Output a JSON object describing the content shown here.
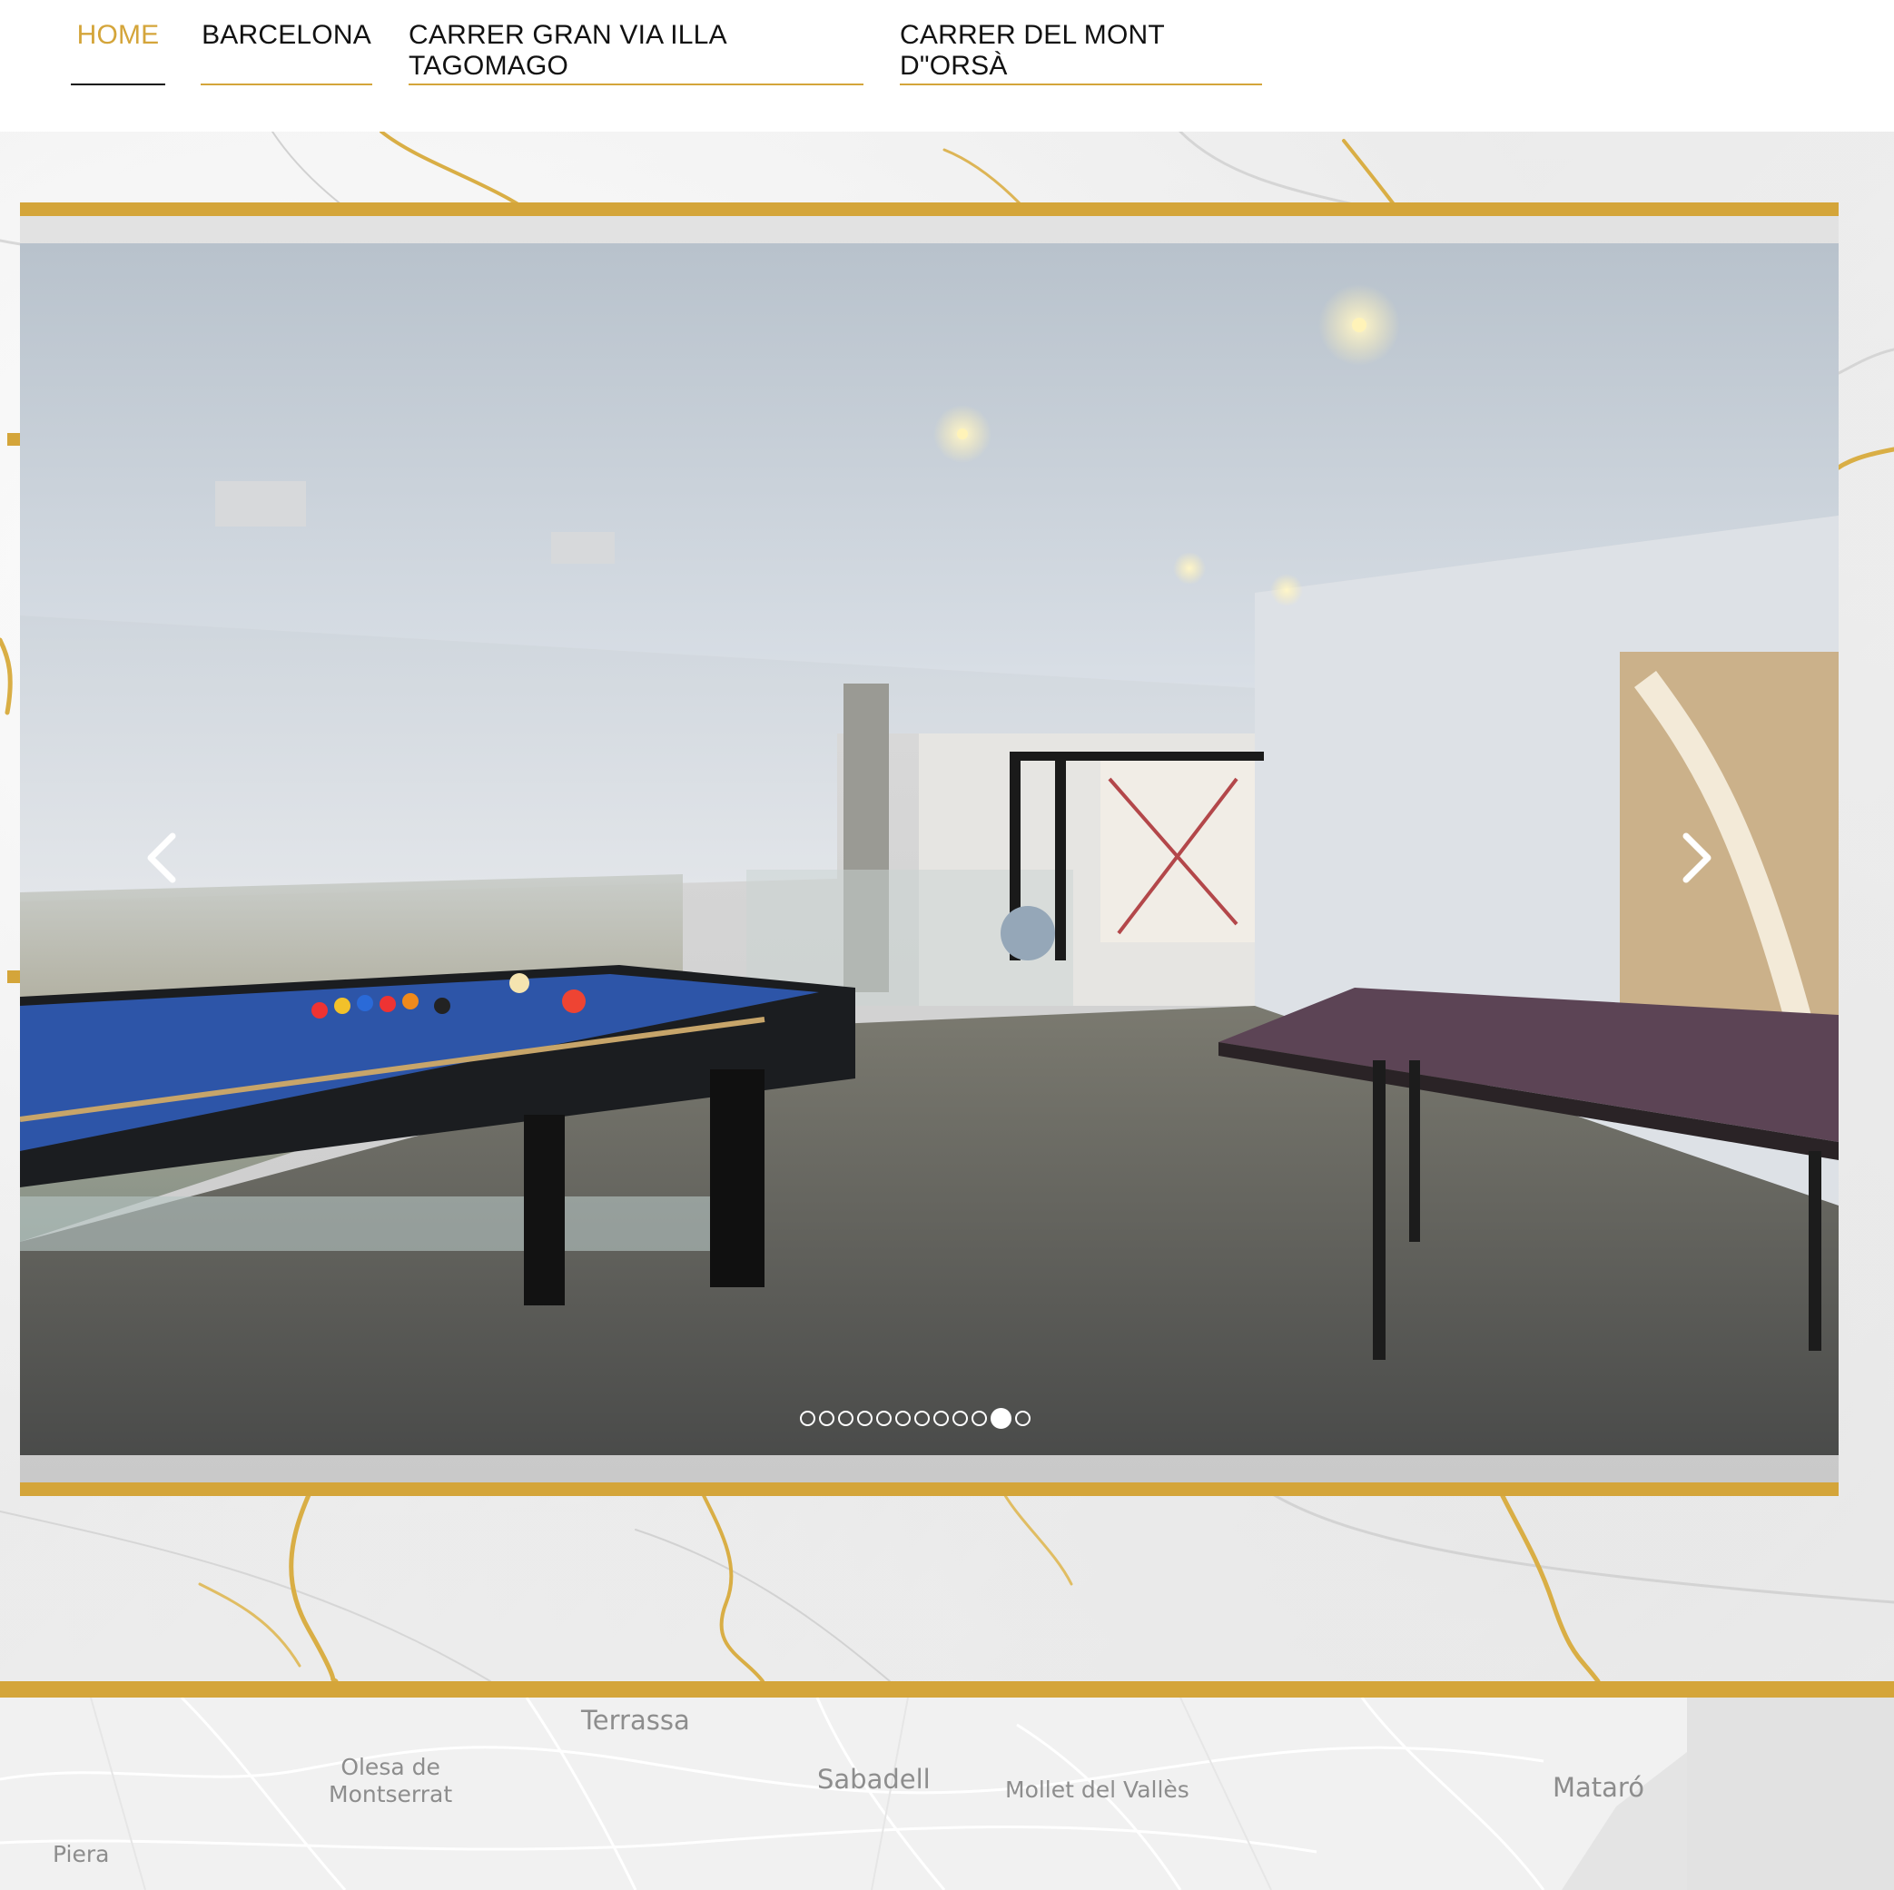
{
  "nav": {
    "items": [
      {
        "label": "HOME",
        "active": true
      },
      {
        "label": "BARCELONA",
        "active": false
      },
      {
        "label": "CARRER GRAN VIA ILLA TAGOMAGO",
        "active": false
      },
      {
        "label": "CARRER DEL MONT D\"ORSÀ",
        "active": false
      }
    ]
  },
  "colors": {
    "accent": "#d4a53a",
    "nav_text": "#111111",
    "marble": "#efefef",
    "map_bg": "#f1f1f1"
  },
  "slideshow": {
    "slide_count": 12,
    "active_slide": 11,
    "prev_icon": "chevron-left-icon",
    "next_icon": "chevron-right-icon"
  },
  "map": {
    "labels": [
      "Terrassa",
      "Olesa de\nMontserrat",
      "Sabadell",
      "Mollet del Vallès",
      "Mataró",
      "Piera"
    ]
  }
}
